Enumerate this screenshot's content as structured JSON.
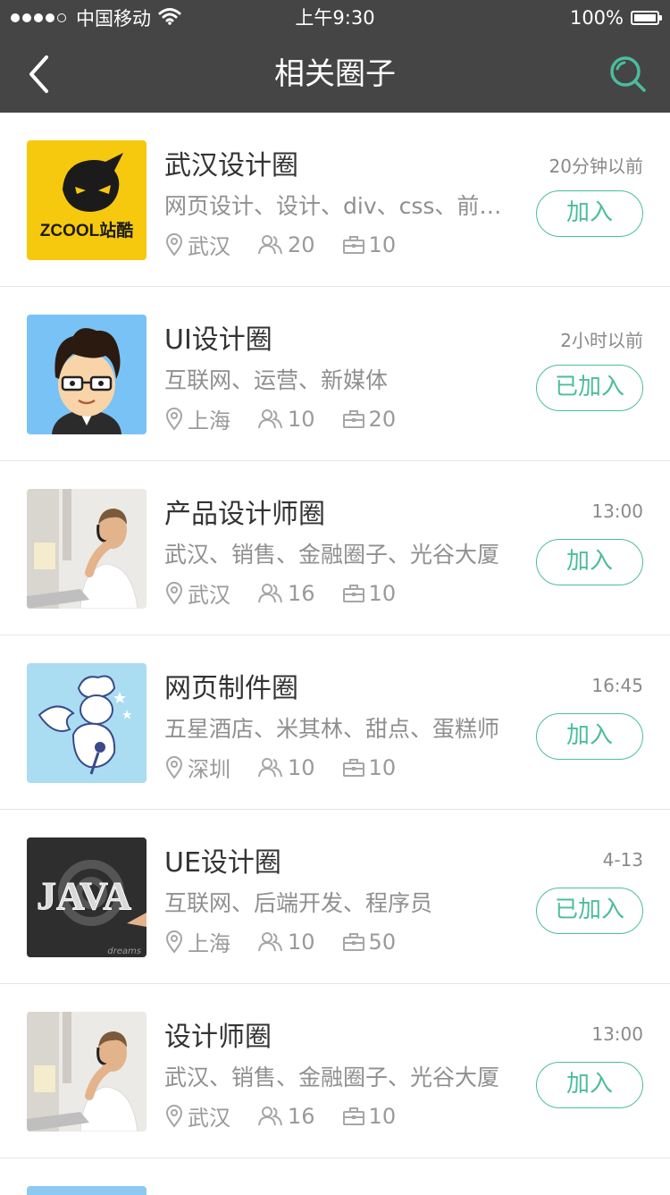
{
  "status_bar": {
    "signal_dots": 5,
    "signal_filled": 4,
    "carrier": "中国移动",
    "time": "上午9:30",
    "battery_percent": "100%",
    "battery_level": 1.0
  },
  "nav": {
    "back_icon": "chevron-left-icon",
    "title": "相关圈子",
    "search_icon": "search-icon"
  },
  "colors": {
    "accent": "#4bbd9e",
    "nav_bg": "#454545"
  },
  "items": [
    {
      "title": "武汉设计圈",
      "time": "20分钟以前",
      "tags": "网页设计、设计、div、css、前端开发",
      "location": "武汉",
      "members": "20",
      "posts": "10",
      "button": "加入",
      "avatar": "zcool-logo"
    },
    {
      "title": "UI设计圈",
      "time": "2小时以前",
      "tags": "互联网、运营、新媒体",
      "location": "上海",
      "members": "10",
      "posts": "20",
      "button": "已加入",
      "avatar": "cartoon-man"
    },
    {
      "title": "产品设计师圈",
      "time": "13:00",
      "tags": "武汉、销售、金融圈子、光谷大厦",
      "location": "武汉",
      "members": "16",
      "posts": "10",
      "button": "加入",
      "avatar": "headset-man-photo"
    },
    {
      "title": "网页制件圈",
      "time": "16:45",
      "tags": "五星酒店、米其林、甜点、蛋糕师",
      "location": "深圳",
      "members": "10",
      "posts": "10",
      "button": "加入",
      "avatar": "angel-chef"
    },
    {
      "title": "UE设计圈",
      "time": "4-13",
      "tags": "互联网、后端开发、程序员",
      "location": "上海",
      "members": "10",
      "posts": "50",
      "button": "已加入",
      "avatar": "java-chalkboard"
    },
    {
      "title": "设计师圈",
      "time": "13:00",
      "tags": "武汉、销售、金融圈子、光谷大厦",
      "location": "武汉",
      "members": "16",
      "posts": "10",
      "button": "加入",
      "avatar": "headset-man-photo"
    }
  ],
  "avatar_text": {
    "zcool": "ZCOOL站酷",
    "java": "JAVA",
    "dreams": "dreams"
  }
}
